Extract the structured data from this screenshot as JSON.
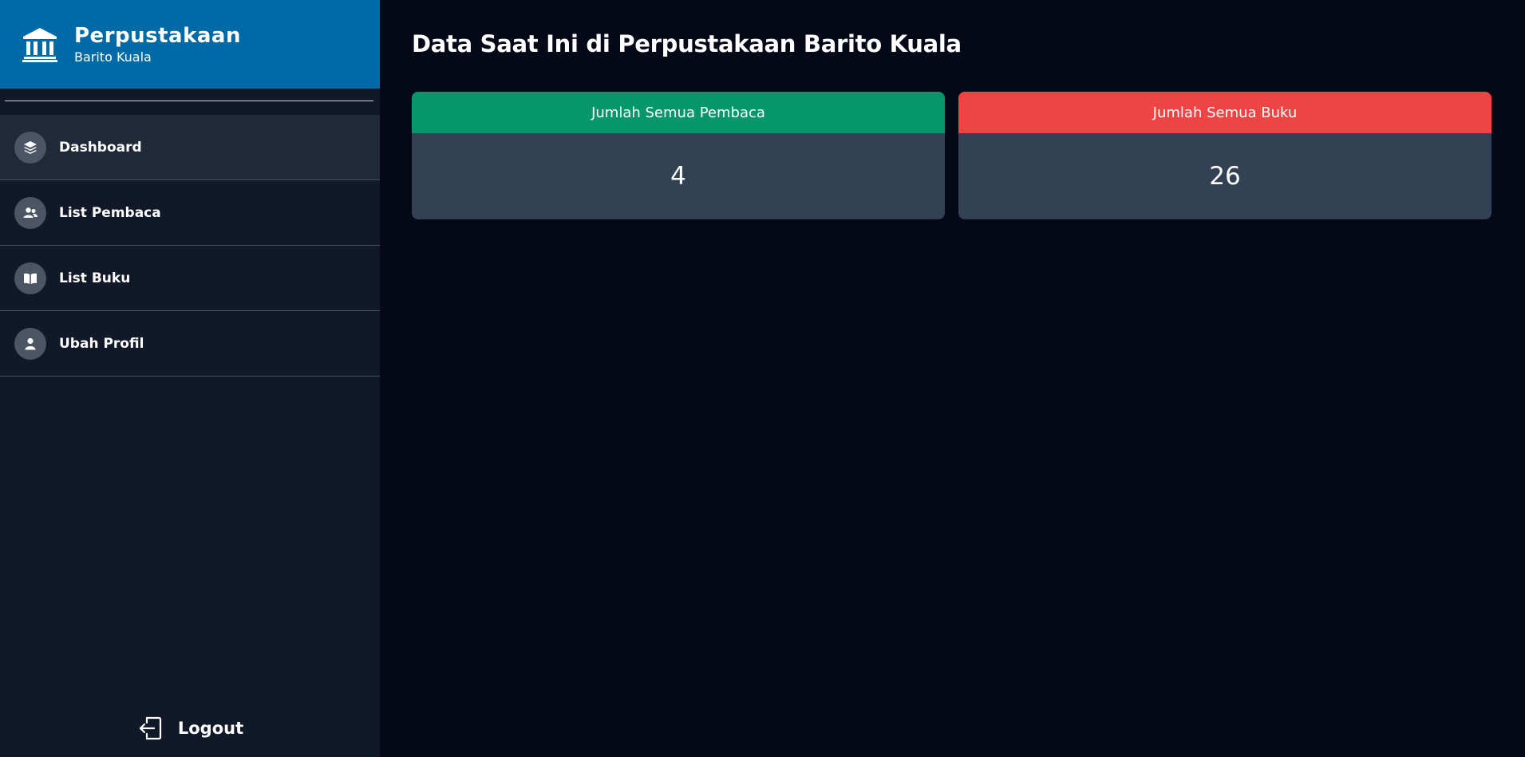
{
  "brand": {
    "title": "Perpustakaan",
    "subtitle": "Barito Kuala",
    "icon": "library-building-icon",
    "color": "#006aa6"
  },
  "sidebar": {
    "items": [
      {
        "label": "Dashboard",
        "icon": "layers-icon",
        "active": true
      },
      {
        "label": "List Pembaca",
        "icon": "users-icon",
        "active": false
      },
      {
        "label": "List Buku",
        "icon": "open-book-icon",
        "active": false
      },
      {
        "label": "Ubah Profil",
        "icon": "user-icon",
        "active": false
      }
    ],
    "logout": {
      "label": "Logout",
      "icon": "logout-icon"
    }
  },
  "main": {
    "title": "Data Saat Ini di Perpustakaan Barito Kuala",
    "cards": [
      {
        "label": "Jumlah Semua Pembaca",
        "value": "4",
        "color": "#059669"
      },
      {
        "label": "Jumlah Semua Buku",
        "value": "26",
        "color": "#ef4444"
      }
    ]
  }
}
